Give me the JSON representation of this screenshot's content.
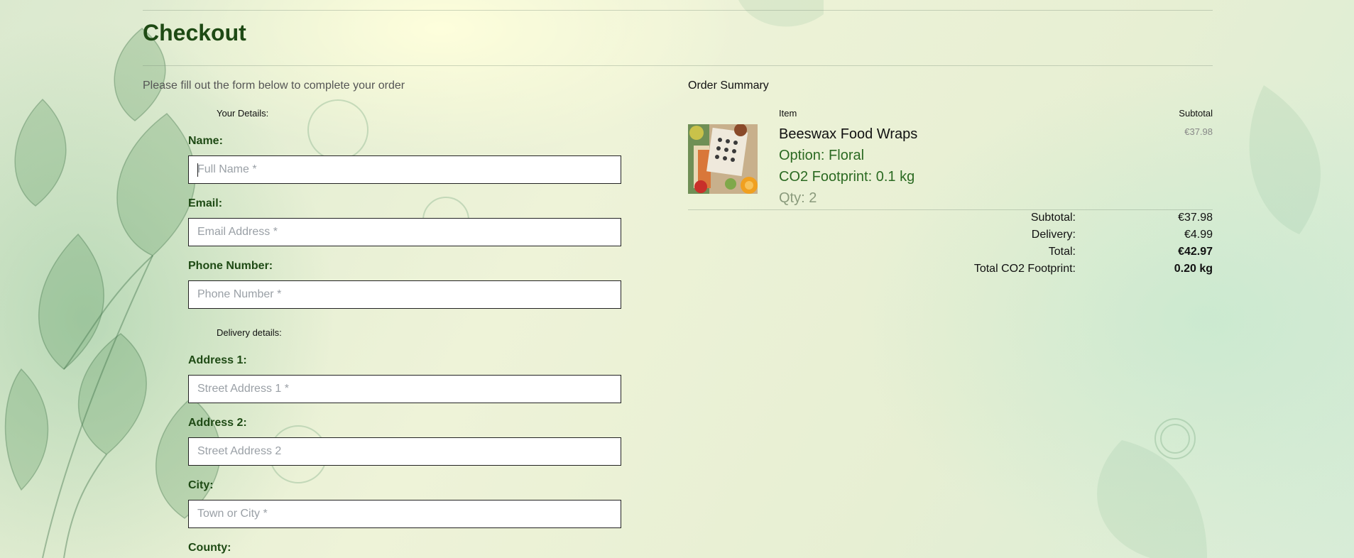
{
  "page": {
    "title": "Checkout",
    "intro": "Please fill out the form below to complete your order"
  },
  "form": {
    "your_details_legend": "Your Details:",
    "delivery_legend": "Delivery details:",
    "fields": {
      "name": {
        "label": "Name:",
        "placeholder": "Full Name *",
        "value": ""
      },
      "email": {
        "label": "Email:",
        "placeholder": "Email Address *",
        "value": ""
      },
      "phone": {
        "label": "Phone Number:",
        "placeholder": "Phone Number *",
        "value": ""
      },
      "address1": {
        "label": "Address 1:",
        "placeholder": "Street Address 1 *",
        "value": ""
      },
      "address2": {
        "label": "Address 2:",
        "placeholder": "Street Address 2",
        "value": ""
      },
      "city": {
        "label": "City:",
        "placeholder": "Town or City *",
        "value": ""
      },
      "county": {
        "label": "County:"
      }
    }
  },
  "order_summary": {
    "title": "Order Summary",
    "col_item": "Item",
    "col_subtotal": "Subtotal",
    "items": [
      {
        "name": "Beeswax Food Wraps",
        "option": "Option: Floral",
        "co2": "CO2 Footprint: 0.1 kg",
        "qty": "Qty: 2",
        "subtotal": "€37.98",
        "image_icon": "beeswax-wraps-photo"
      }
    ],
    "totals": {
      "subtotal_label": "Subtotal:",
      "subtotal_value": "€37.98",
      "delivery_label": "Delivery:",
      "delivery_value": "€4.99",
      "total_label": "Total:",
      "total_value": "€42.97",
      "co2_label": "Total CO2 Footprint:",
      "co2_value": "0.20 kg"
    }
  },
  "colors": {
    "heading_green": "#1e4a14",
    "meta_green": "#2b6a22",
    "background": "#e7efd3"
  }
}
